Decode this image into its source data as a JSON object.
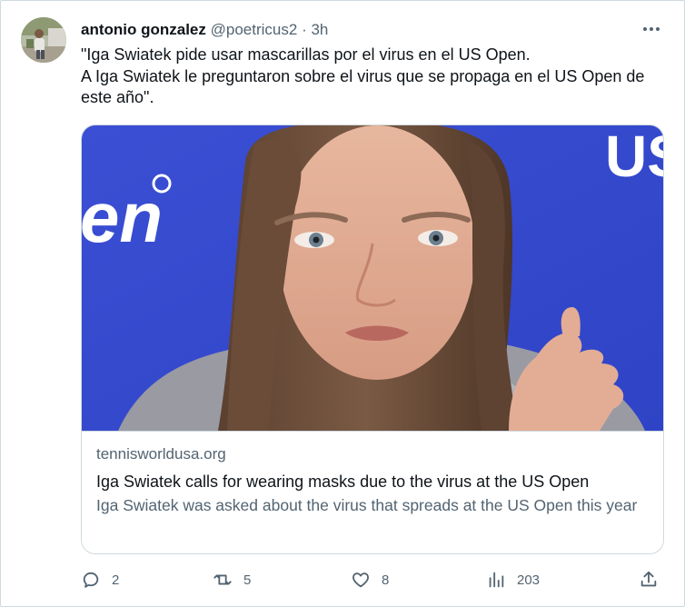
{
  "tweet": {
    "author_name": "antonio gonzalez",
    "handle": "@poetricus2",
    "separator": "·",
    "time": "3h",
    "text_line1": "\"Iga Swiatek pide usar mascarillas por el virus en el US Open.",
    "text_line2": "A Iga Swiatek le preguntaron sobre el virus que se propaga en el US Open de este año\"."
  },
  "card": {
    "domain": "tennisworldusa.org",
    "title": "Iga Swiatek calls for wearing masks due to the virus at the US Open",
    "description": "Iga Swiatek was asked about the virus that spreads at the US Open this year",
    "backdrop_left_text": "en",
    "backdrop_right_text": "US"
  },
  "actions": {
    "replies": "2",
    "retweets": "5",
    "likes": "8",
    "views": "203"
  },
  "colors": {
    "text_primary": "#0f1419",
    "text_secondary": "#536471",
    "border": "#cfd9de",
    "backdrop_blue": "#3f54d6"
  },
  "icons": [
    "more-icon",
    "reply-icon",
    "retweet-icon",
    "like-icon",
    "views-icon",
    "share-icon"
  ]
}
